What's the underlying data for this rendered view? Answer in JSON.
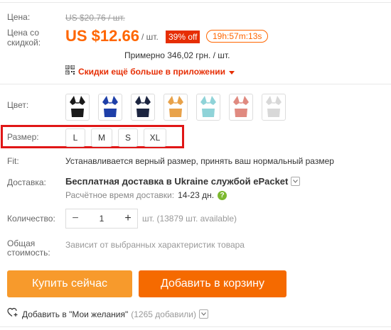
{
  "price": {
    "label": "Цена:",
    "old": "US $20.76 / шт.",
    "discounted_label_1": "Цена со",
    "discounted_label_2": "скидкой:",
    "new": "US $12.66",
    "per_unit": "/ шт.",
    "discount": "39% off",
    "timer": "19h:57m:13s",
    "local": "Примерно 346,02 грн. / шт.",
    "app_promo": "Скидки ещё больше в приложении"
  },
  "color": {
    "label": "Цвет:",
    "swatches": [
      {
        "top": "#1a1a1a",
        "bottom": "#1a1a1a"
      },
      {
        "top": "#1e3fa8",
        "bottom": "#1e3fa8"
      },
      {
        "top": "#1c2540",
        "bottom": "#1c2540"
      },
      {
        "top": "#e8a24a",
        "bottom": "#e8a24a"
      },
      {
        "top": "#8fd3d8",
        "bottom": "#8fd3d8"
      },
      {
        "top": "#e08a80",
        "bottom": "#e08a80"
      },
      {
        "top": "#d8d8d8",
        "bottom": "#d8d8d8"
      }
    ]
  },
  "size": {
    "label": "Размер:",
    "options": [
      "L",
      "M",
      "S",
      "XL"
    ]
  },
  "fit": {
    "label": "Fit:",
    "value": "Устанавливается верный размер, принять ваш нормальный размер"
  },
  "delivery": {
    "label": "Доставка:",
    "value": "Бесплатная доставка в Ukraine службой ePacket",
    "estimate_label": "Расчётное время доставки:",
    "estimate_value": "14-23 дн."
  },
  "quantity": {
    "label": "Количество:",
    "minus": "−",
    "value": "1",
    "plus": "+",
    "available": "шт. (13879 шт. available)"
  },
  "total": {
    "label_1": "Общая",
    "label_2": "стоимость:",
    "value": "Зависит от выбранных характеристик товара"
  },
  "actions": {
    "buy": "Купить сейчас",
    "cart": "Добавить в корзину",
    "wishlist": "Добавить в \"Мои желания\"",
    "wishlist_count": "(1265 добавили)"
  },
  "colors": {
    "accent": "#f60",
    "discount_bg": "#e62e04",
    "buy_bg": "#f79a2c",
    "cart_bg": "#f56a00",
    "highlight": "#e01616"
  }
}
